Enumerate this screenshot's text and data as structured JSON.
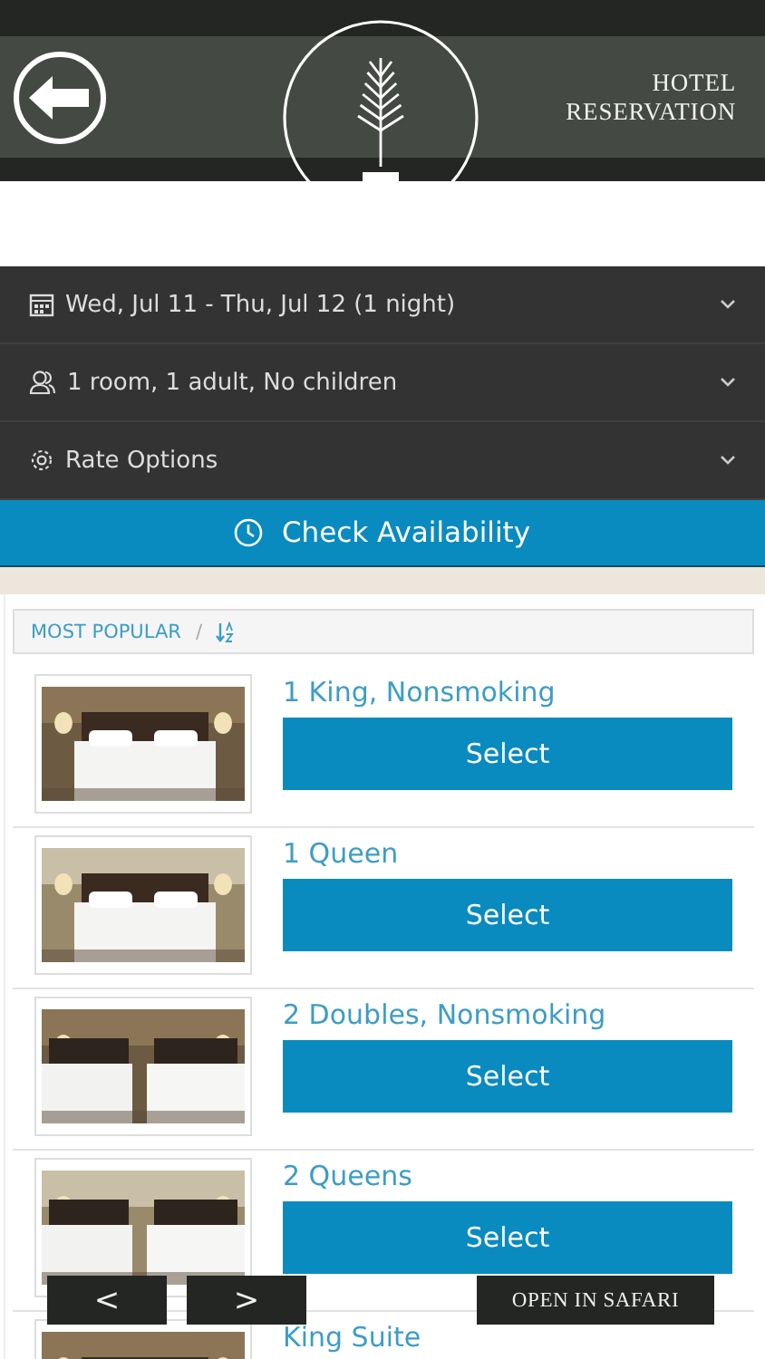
{
  "header": {
    "title": "HOTEL RESERVATION"
  },
  "options": [
    {
      "kind": "calendar",
      "label": "Wed, Jul 11 - Thu, Jul 12 (1 night)"
    },
    {
      "kind": "guests",
      "label": "1 room, 1 adult, No children"
    },
    {
      "kind": "settings",
      "label": "Rate Options"
    }
  ],
  "check_button": {
    "label": "Check Availability"
  },
  "sort_bar": {
    "label": "MOST POPULAR",
    "separator": "/"
  },
  "rooms": [
    {
      "name": "1 King, Nonsmoking",
      "button": "Select"
    },
    {
      "name": "1 Queen",
      "button": "Select"
    },
    {
      "name": "2 Doubles, Nonsmoking",
      "button": "Select"
    },
    {
      "name": "2 Queens",
      "button": "Select"
    },
    {
      "name": "King Suite"
    }
  ],
  "toolbar": {
    "previous": "<",
    "next": ">",
    "open": "OPEN IN SAFARI"
  }
}
